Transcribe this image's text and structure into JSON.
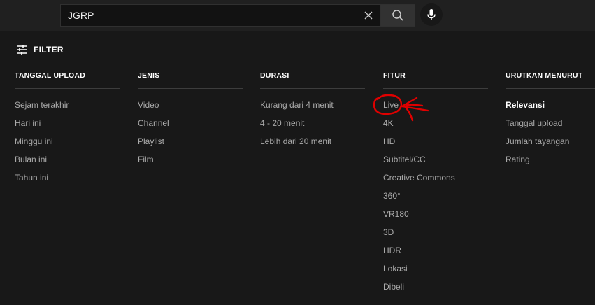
{
  "search": {
    "query": "JGRP",
    "clear_icon": "close-icon",
    "search_icon": "search-icon",
    "mic_icon": "microphone-icon"
  },
  "filter": {
    "toggle_label": "FILTER",
    "icon": "tune-icon"
  },
  "columns": [
    {
      "title": "TANGGAL UPLOAD",
      "options": [
        "Sejam terakhir",
        "Hari ini",
        "Minggu ini",
        "Bulan ini",
        "Tahun ini"
      ]
    },
    {
      "title": "JENIS",
      "options": [
        "Video",
        "Channel",
        "Playlist",
        "Film"
      ]
    },
    {
      "title": "DURASI",
      "options": [
        "Kurang dari 4 menit",
        "4 - 20 menit",
        "Lebih dari 20 menit"
      ]
    },
    {
      "title": "FITUR",
      "options": [
        "Live",
        "4K",
        "HD",
        "Subtitel/CC",
        "Creative Commons",
        "360°",
        "VR180",
        "3D",
        "HDR",
        "Lokasi",
        "Dibeli"
      ]
    },
    {
      "title": "URUTKAN MENURUT",
      "options": [
        "Relevansi",
        "Tanggal upload",
        "Jumlah tayangan",
        "Rating"
      ],
      "selected": "Relevansi"
    }
  ],
  "colors": {
    "background": "#181818",
    "topbar": "#202020",
    "text_muted": "#aaaaaa",
    "text_active": "#ffffff",
    "annotation_red": "#e00000"
  }
}
